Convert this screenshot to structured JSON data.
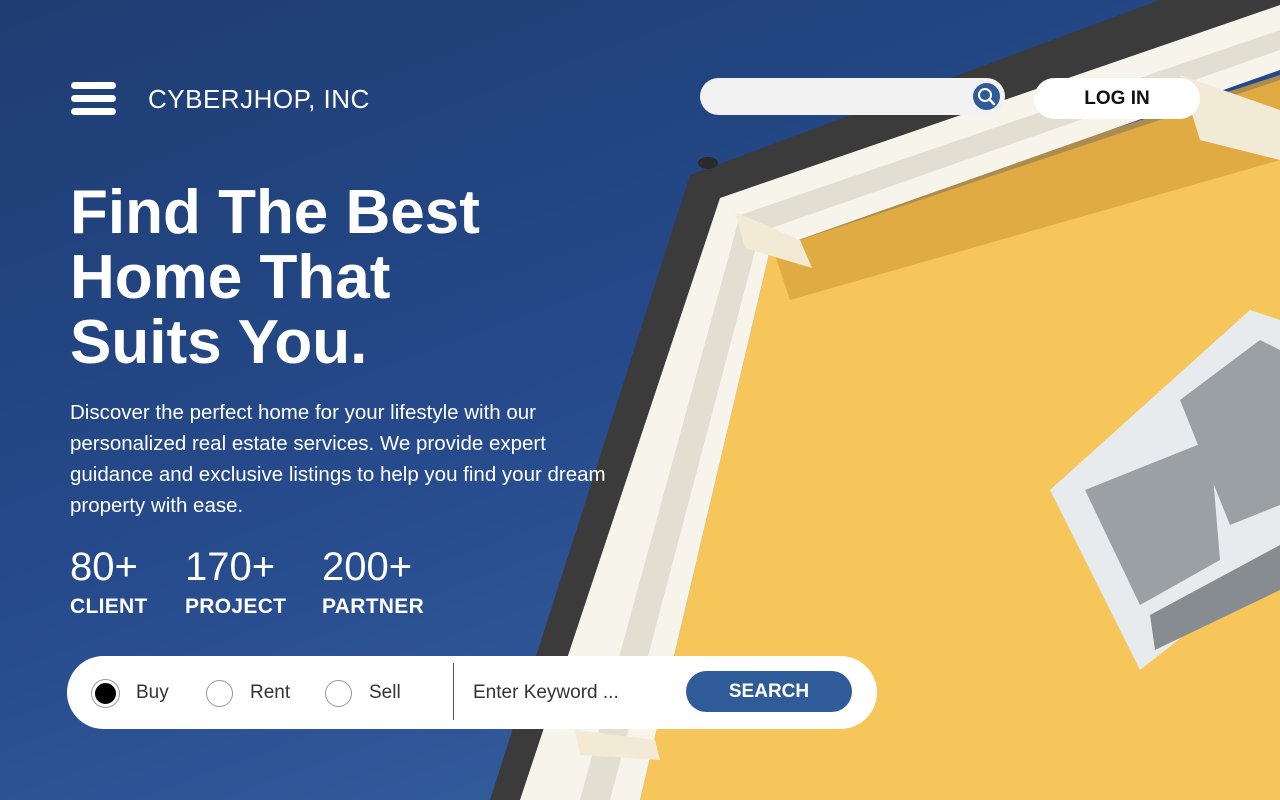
{
  "header": {
    "menu_icon": "hamburger-menu-icon",
    "brand": "CYBERJHOP, INC",
    "search_placeholder": "",
    "search_icon": "search-icon",
    "login_label": "LOG IN"
  },
  "hero": {
    "headline": [
      "Find The Best",
      "Home That",
      "Suits You."
    ],
    "description": "Discover the perfect home for your lifestyle with our personalized real estate services. We provide expert guidance and exclusive listings to help you find your dream property with ease.",
    "stats": [
      {
        "value": "80+",
        "label": "CLIENT"
      },
      {
        "value": "170+",
        "label": "PROJECT"
      },
      {
        "value": "200+",
        "label": "PARTNER"
      }
    ]
  },
  "search_bar": {
    "options": [
      {
        "label": "Buy",
        "selected": true
      },
      {
        "label": "Rent",
        "selected": false
      },
      {
        "label": "Sell",
        "selected": false
      }
    ],
    "keyword_placeholder": "Enter Keyword ...",
    "search_label": "SEARCH"
  },
  "colors": {
    "sky_dark": "#1e3d72",
    "sky_light": "#3a66a8",
    "accent_blue": "#2f5b98",
    "wall_yellow": "#f6c65a",
    "trim_white": "#f7f4ec",
    "roof_dark": "#3b3b3b"
  }
}
